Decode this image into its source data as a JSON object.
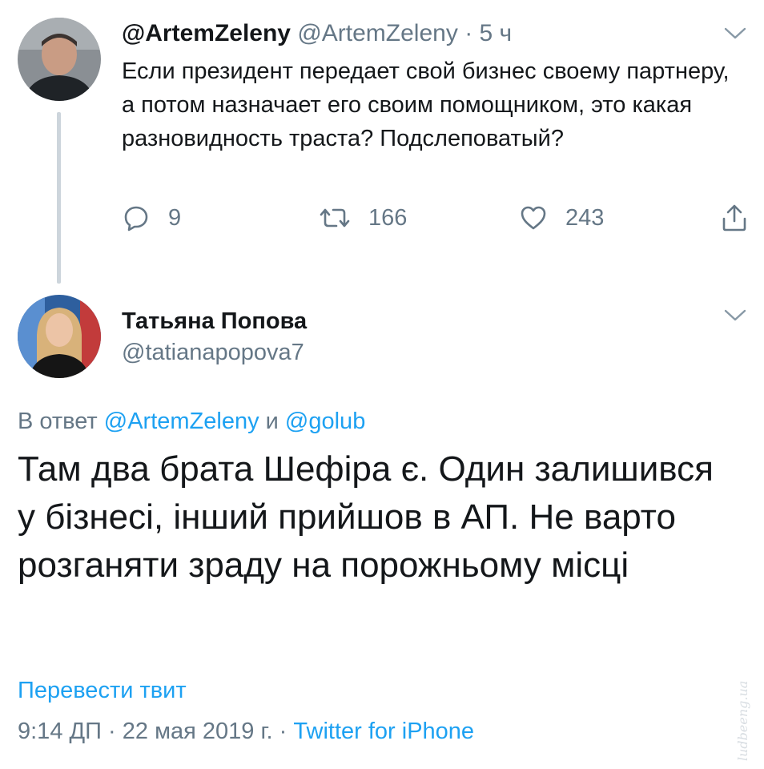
{
  "tweet1": {
    "display_name": "@ArtemZeleny",
    "handle": "@ArtemZeleny",
    "separator": "·",
    "time": "5 ч",
    "text": "Если президент передает свой бизнес своему партнеру, а потом назначает его своим помощником, это какая разновидность траста? Подслеповатый?",
    "reply_count": "9",
    "retweet_count": "166",
    "like_count": "243"
  },
  "tweet2": {
    "display_name": "Татьяна Попова",
    "handle": "@tatianapopova7",
    "reply_prefix": "В ответ",
    "reply_user1": "@ArtemZeleny",
    "reply_conjunction": "и",
    "reply_user2": "@golub",
    "text": "Там два брата Шефіра є. Один залишився у бізнесі, інший прийшов в АП. Не варто розганяти зраду на порожньому місці",
    "translate_label": "Перевести твит",
    "time": "9:14 ДП",
    "separator1": "·",
    "date": "22 мая 2019 г.",
    "separator2": "·",
    "source": "Twitter for iPhone"
  },
  "icons": {
    "reply": "reply-icon",
    "retweet": "retweet-icon",
    "like": "heart-icon",
    "share": "share-icon",
    "menu": "chevron-down-icon"
  },
  "colors": {
    "text": "#14171a",
    "secondary": "#657786",
    "link": "#1da1f2",
    "thread_line": "#cdd5dc"
  },
  "watermark": "ludbeeng.ua"
}
